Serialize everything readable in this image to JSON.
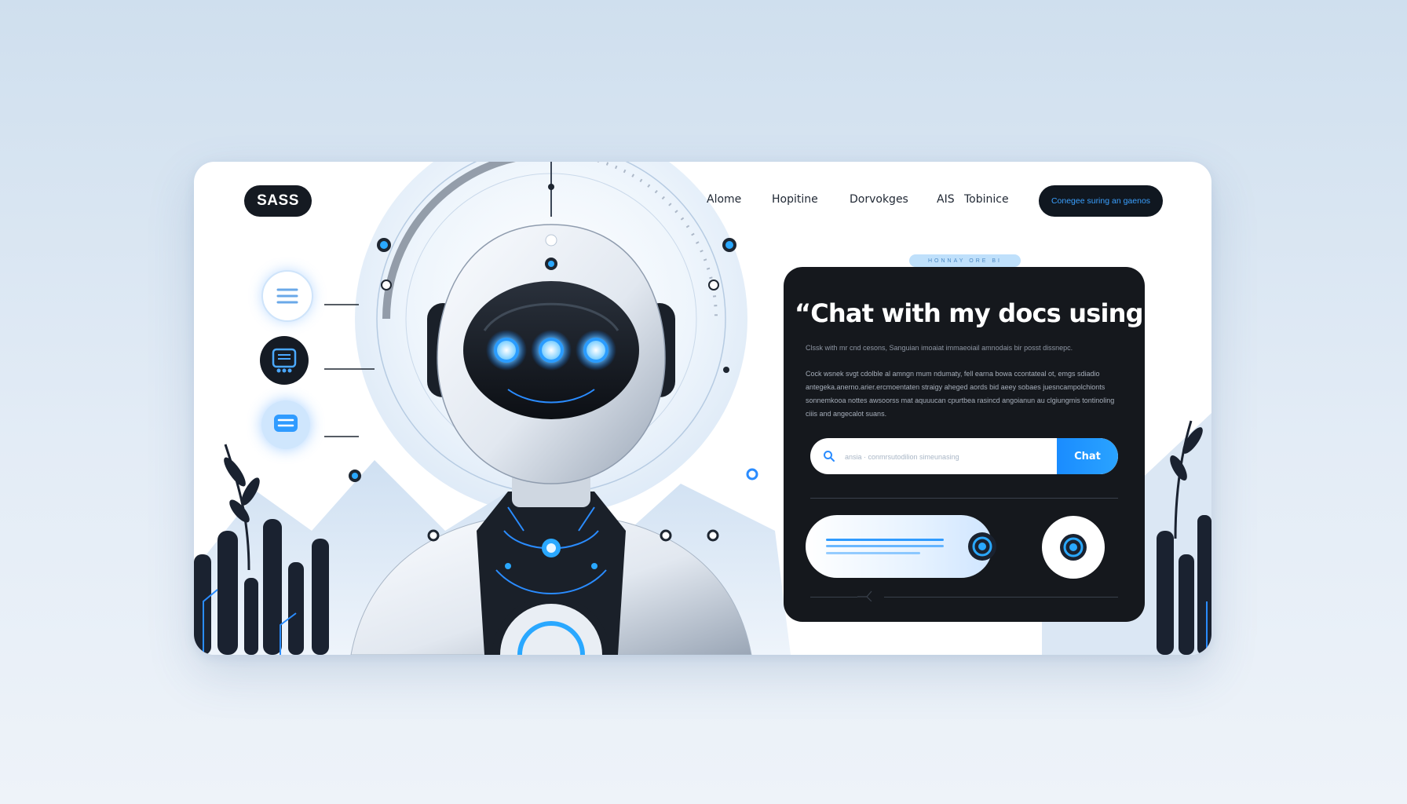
{
  "brand": {
    "logo": "SASS"
  },
  "nav": {
    "items": [
      "Alome",
      "Hopitine",
      "Dorvokges",
      "AIS",
      "Tobinice"
    ],
    "cta": "Conegee suring an gaenos"
  },
  "hero": {
    "tag": "HONNAY ORE BI",
    "headline": "“Chat with my docs using AI”",
    "subline": "Clssk with mr cnd cesons, Sanguian imoaiat immaeoiail amnodais bir posst dissnepc.",
    "paragraph": "Cock wsnek svgt cdolble al amngn mum ndumaty, fell earna bowa ccontateal ot, emgs sdiadio antegeka.anerno.arier.ercmoentaten straigy aheged aords bid aeey sobaes juesncampolchionts sonnemkooa nottes awsoorss mat aquuucan cpurtbea rasincd angoianun au clgiungmis tontinoling ciiis and angecalot suans.",
    "search": {
      "placeholder": "ansia · conmrsutodilion simeunasing",
      "button": "Chat"
    }
  },
  "icons": {
    "side": [
      "menu-lines-icon",
      "chat-window-icon",
      "message-bubble-icon"
    ],
    "search": "search-icon",
    "record": "record-icon"
  },
  "colors": {
    "accent": "#1a8cff",
    "dark": "#15181d",
    "glow": "#2aa8ff",
    "background": "#dbe7f3"
  }
}
